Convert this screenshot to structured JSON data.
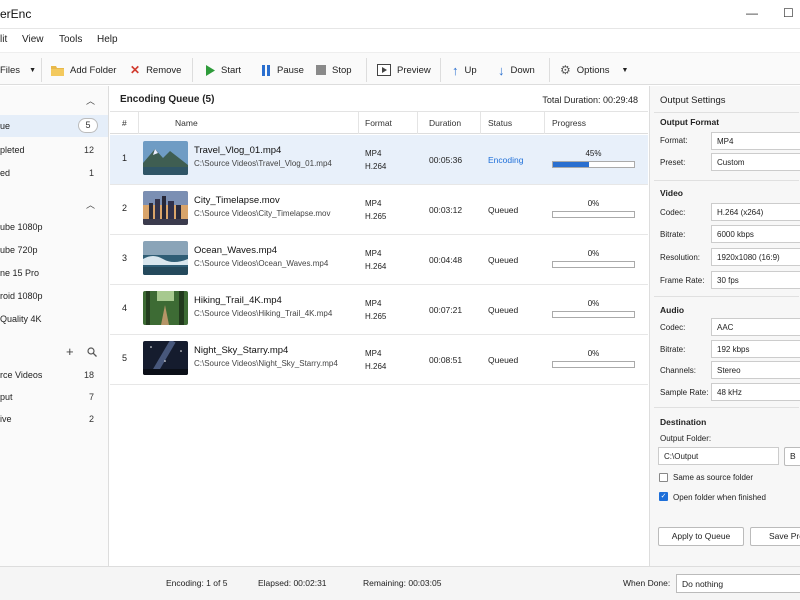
{
  "window": {
    "title": "erEnc",
    "minimize": "—",
    "maximize": "☐"
  },
  "menu": [
    "lit",
    "View",
    "Tools",
    "Help"
  ],
  "toolbar": {
    "add_files": "Files",
    "add_folder": "Add Folder",
    "remove": "Remove",
    "start": "Start",
    "pause": "Pause",
    "stop": "Stop",
    "preview": "Preview",
    "up": "Up",
    "down": "Down",
    "options": "Options"
  },
  "sidebar": {
    "queue_items": [
      {
        "label": "ue",
        "count": "5"
      },
      {
        "label": "pleted",
        "count": "12"
      },
      {
        "label": "ed",
        "count": "1"
      }
    ],
    "presets": [
      "ube 1080p",
      "ube 720p",
      "ne 15 Pro",
      "roid 1080p",
      "Quality 4K"
    ],
    "folders": [
      {
        "label": "rce Videos",
        "count": "18"
      },
      {
        "label": "put",
        "count": "7"
      },
      {
        "label": "ive",
        "count": "2"
      }
    ]
  },
  "queue": {
    "title": "Encoding Queue (5)",
    "total_duration": "Total Duration: 00:29:48",
    "columns": [
      "#",
      "Name",
      "Format",
      "Duration",
      "Status",
      "Progress"
    ],
    "rows": [
      {
        "num": "1",
        "name": "Travel_Vlog_01.mp4",
        "path": "C:\\Source Videos\\Travel_Vlog_01.mp4",
        "fmt1": "MP4",
        "fmt2": "H.264",
        "duration": "00:05:36",
        "status": "Encoding",
        "progress": "45%",
        "progress_value": 0.45
      },
      {
        "num": "2",
        "name": "City_Timelapse.mov",
        "path": "C:\\Source Videos\\City_Timelapse.mov",
        "fmt1": "MP4",
        "fmt2": "H.265",
        "duration": "00:03:12",
        "status": "Queued",
        "progress": "0%",
        "progress_value": 0
      },
      {
        "num": "3",
        "name": "Ocean_Waves.mp4",
        "path": "C:\\Source Videos\\Ocean_Waves.mp4",
        "fmt1": "MP4",
        "fmt2": "H.264",
        "duration": "00:04:48",
        "status": "Queued",
        "progress": "0%",
        "progress_value": 0
      },
      {
        "num": "4",
        "name": "Hiking_Trail_4K.mp4",
        "path": "C:\\Source Videos\\Hiking_Trail_4K.mp4",
        "fmt1": "MP4",
        "fmt2": "H.265",
        "duration": "00:07:21",
        "status": "Queued",
        "progress": "0%",
        "progress_value": 0
      },
      {
        "num": "5",
        "name": "Night_Sky_Starry.mp4",
        "path": "C:\\Source Videos\\Night_Sky_Starry.mp4",
        "fmt1": "MP4",
        "fmt2": "H.264",
        "duration": "00:08:51",
        "status": "Queued",
        "progress": "0%",
        "progress_value": 0
      }
    ]
  },
  "settings": {
    "title": "Output Settings",
    "output_format": "Output Format",
    "format_label": "Format:",
    "format_value": "MP4",
    "preset_label": "Preset:",
    "preset_value": "Custom",
    "video": "Video",
    "codec_label": "Codec:",
    "codec_value": "H.264 (x264)",
    "bitrate_label": "Bitrate:",
    "bitrate_value": "6000 kbps",
    "resolution_label": "Resolution:",
    "resolution_value": "1920x1080 (16:9)",
    "framerate_label": "Frame Rate:",
    "framerate_value": "30 fps",
    "audio": "Audio",
    "acodec_label": "Codec:",
    "acodec_value": "AAC",
    "abitrate_label": "Bitrate:",
    "abitrate_value": "192 kbps",
    "channels_label": "Channels:",
    "channels_value": "Stereo",
    "samplerate_label": "Sample Rate:",
    "samplerate_value": "48 kHz",
    "destination": "Destination",
    "output_folder_label": "Output Folder:",
    "output_folder_value": "C:\\Output",
    "browse": "B",
    "same_as_source": "Same as source folder",
    "open_when_finished": "Open folder when finished",
    "apply_to_queue": "Apply to Queue",
    "save_preset": "Save Pre"
  },
  "status": {
    "encoding": "Encoding:  1 of 5",
    "elapsed": "Elapsed:  00:02:31",
    "remaining": "Remaining:  00:03:05",
    "when_done_label": "When Done:",
    "when_done_value": "Do nothing"
  },
  "colors": {
    "accent": "#1e6fd9",
    "selection": "#e8f0fa"
  }
}
